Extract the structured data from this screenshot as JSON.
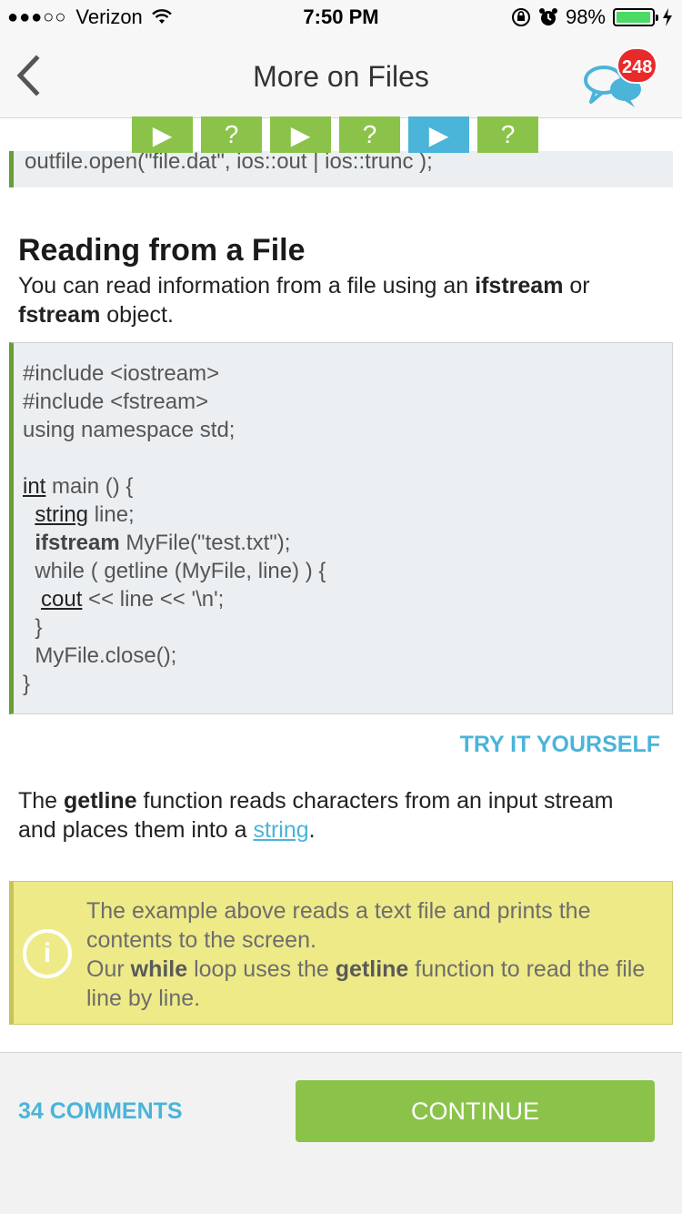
{
  "status_bar": {
    "signal": "●●●○○",
    "carrier": "Verizon",
    "time": "7:50 PM",
    "battery_percent": "98%",
    "battery_level": 0.98
  },
  "nav": {
    "title": "More on Files",
    "badge_count": "248"
  },
  "progress": {
    "steps": [
      {
        "type": "play",
        "glyph": "▶",
        "state": "done"
      },
      {
        "type": "quiz",
        "glyph": "?",
        "state": "done"
      },
      {
        "type": "play",
        "glyph": "▶",
        "state": "done"
      },
      {
        "type": "quiz",
        "glyph": "?",
        "state": "done"
      },
      {
        "type": "play",
        "glyph": "▶",
        "state": "active"
      },
      {
        "type": "quiz",
        "glyph": "?",
        "state": "done"
      }
    ]
  },
  "content": {
    "prev_code": "outfile.open(\"file.dat\", ios::out | ios::trunc );",
    "heading": "Reading from a File",
    "intro": {
      "before": "You can read information from a file using an ",
      "bold1": "ifstream",
      "middle": " or ",
      "bold2": "fstream",
      "after": " object."
    },
    "code": {
      "l1": "#include <iostream>",
      "l2": "#include <fstream>",
      "l3": "using namespace std;",
      "l5_kw": "int",
      "l5_rest": " main () {",
      "l6_indent": "  ",
      "l6_kw": "string",
      "l6_rest": " line;",
      "l7_indent": "  ",
      "l7_kw": "ifstream",
      "l7_rest": " MyFile(\"test.txt\");",
      "l8": "  while ( getline (MyFile, line) ) {",
      "l9_indent": "   ",
      "l9_kw": "cout",
      "l9_rest": " << line << '\\n';",
      "l10": "  }",
      "l11": "  MyFile.close();",
      "l12": "}"
    },
    "try_label": "TRY IT YOURSELF",
    "desc": {
      "before": "The ",
      "bold": "getline",
      "middle": " function reads characters from an input stream and places them into a ",
      "link": "string",
      "after": "."
    },
    "note": {
      "icon": "i",
      "line1": "The example above reads a text file and prints the contents to the screen.",
      "p2_before": "Our ",
      "p2_bold1": "while",
      "p2_middle": " loop uses the ",
      "p2_bold2": "getline",
      "p2_after": " function to read the file line by line."
    }
  },
  "footer": {
    "comments_label": "34 COMMENTS",
    "continue_label": "CONTINUE"
  },
  "colors": {
    "accent_green": "#8bc34a",
    "accent_blue": "#4ab4d9",
    "badge_red": "#e82a2a",
    "note_yellow": "#eeea88"
  }
}
